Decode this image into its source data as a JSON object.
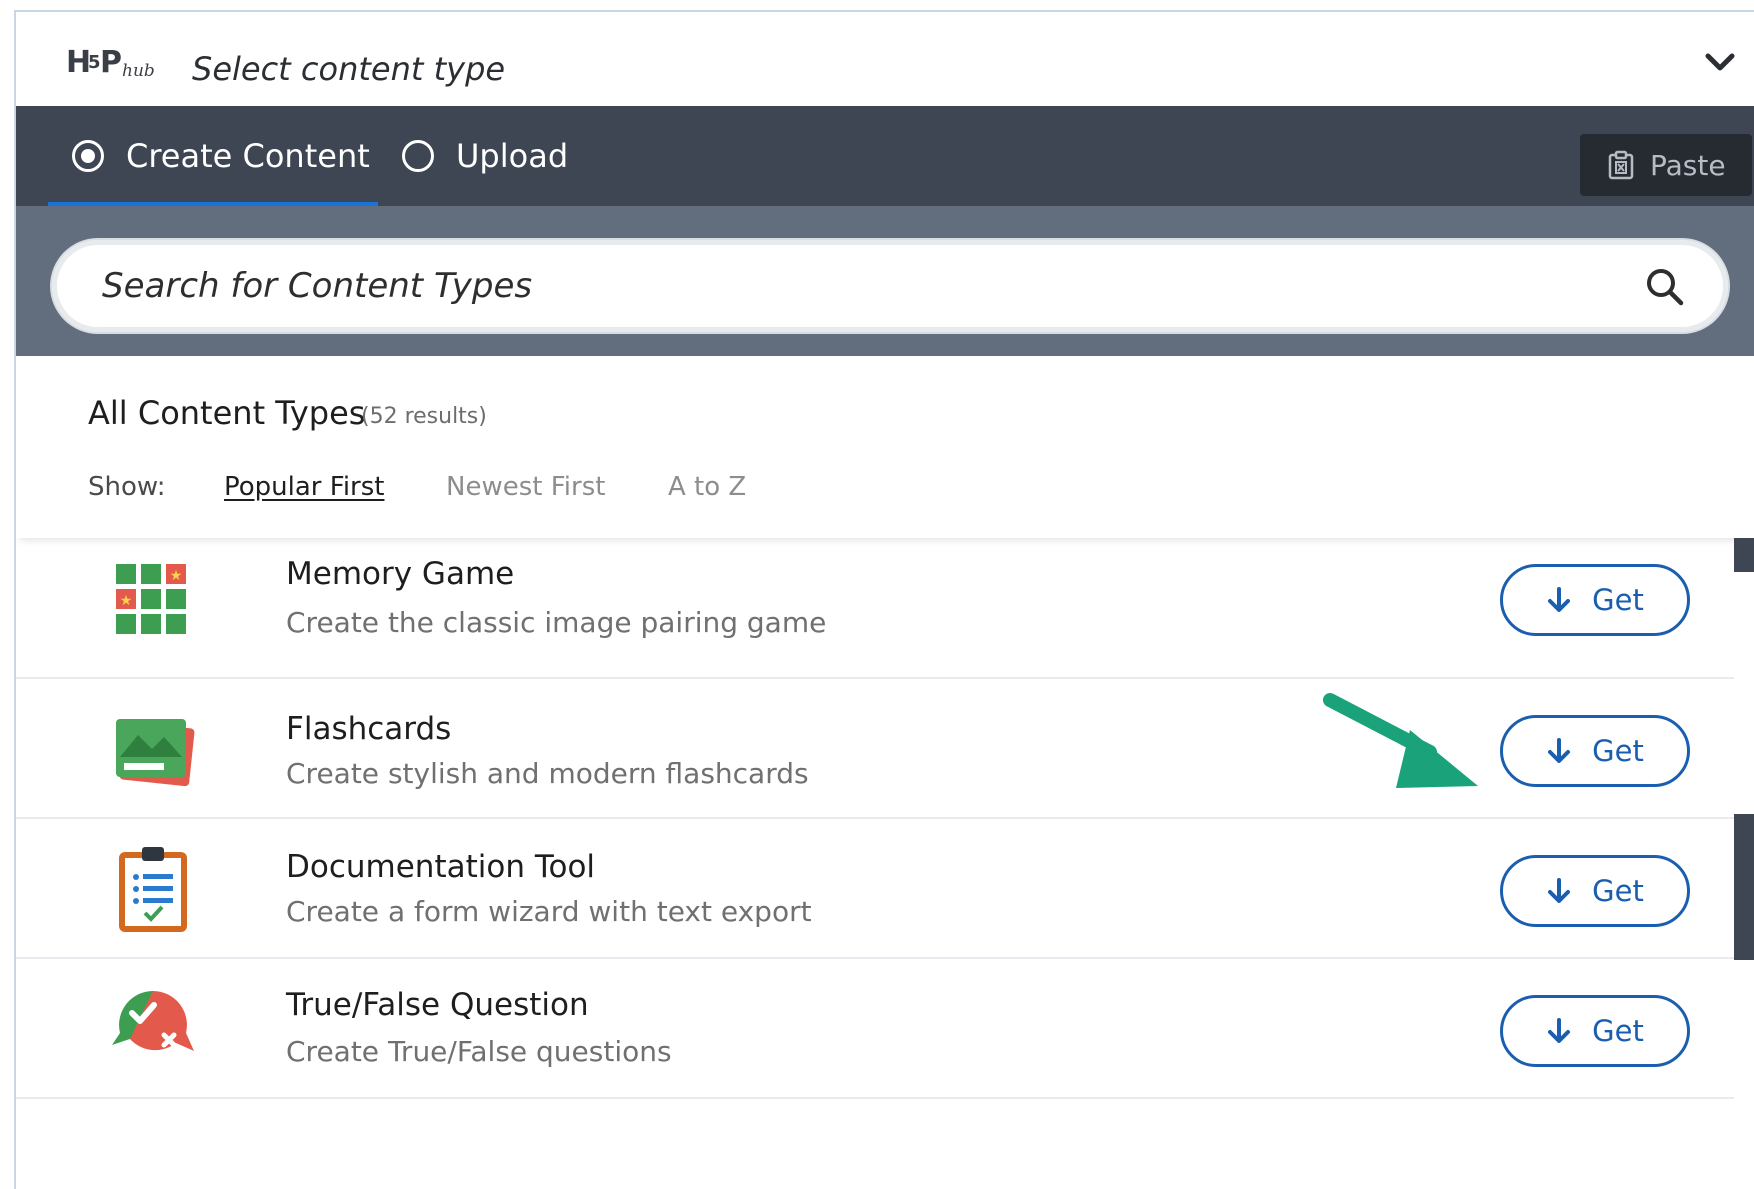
{
  "header": {
    "logo_text": "H5P hub",
    "title": "Select content type",
    "toggle_icon": "chevron-down-icon"
  },
  "tabs": [
    {
      "label": "Create Content",
      "selected": true
    },
    {
      "label": "Upload",
      "selected": false
    }
  ],
  "paste": {
    "label": "Paste",
    "icon": "clipboard-icon"
  },
  "search": {
    "placeholder": "Search for Content Types",
    "value": "",
    "icon": "search-icon"
  },
  "list": {
    "title": "All Content Types",
    "count": "(52 results)",
    "show_label": "Show:",
    "sort_options": [
      {
        "label": "Popular First",
        "active": true
      },
      {
        "label": "Newest First",
        "active": false
      },
      {
        "label": "A to Z",
        "active": false
      }
    ]
  },
  "items": [
    {
      "title": "Memory Game",
      "description": "Create the classic image pairing game",
      "button": "Get",
      "icon": "memory-game-icon"
    },
    {
      "title": "Flashcards",
      "description": "Create stylish and modern flashcards",
      "button": "Get",
      "icon": "flashcards-icon"
    },
    {
      "title": "Documentation Tool",
      "description": "Create a form wizard with text export",
      "button": "Get",
      "icon": "documentation-tool-icon"
    },
    {
      "title": "True/False Question",
      "description": "Create True/False questions",
      "button": "Get",
      "icon": "true-false-icon"
    }
  ],
  "colors": {
    "tabs_bar": "#3e4653",
    "search_area": "#626d7e",
    "accent_blue": "#1a5eb0",
    "annotation_arrow": "#1aa37a"
  }
}
